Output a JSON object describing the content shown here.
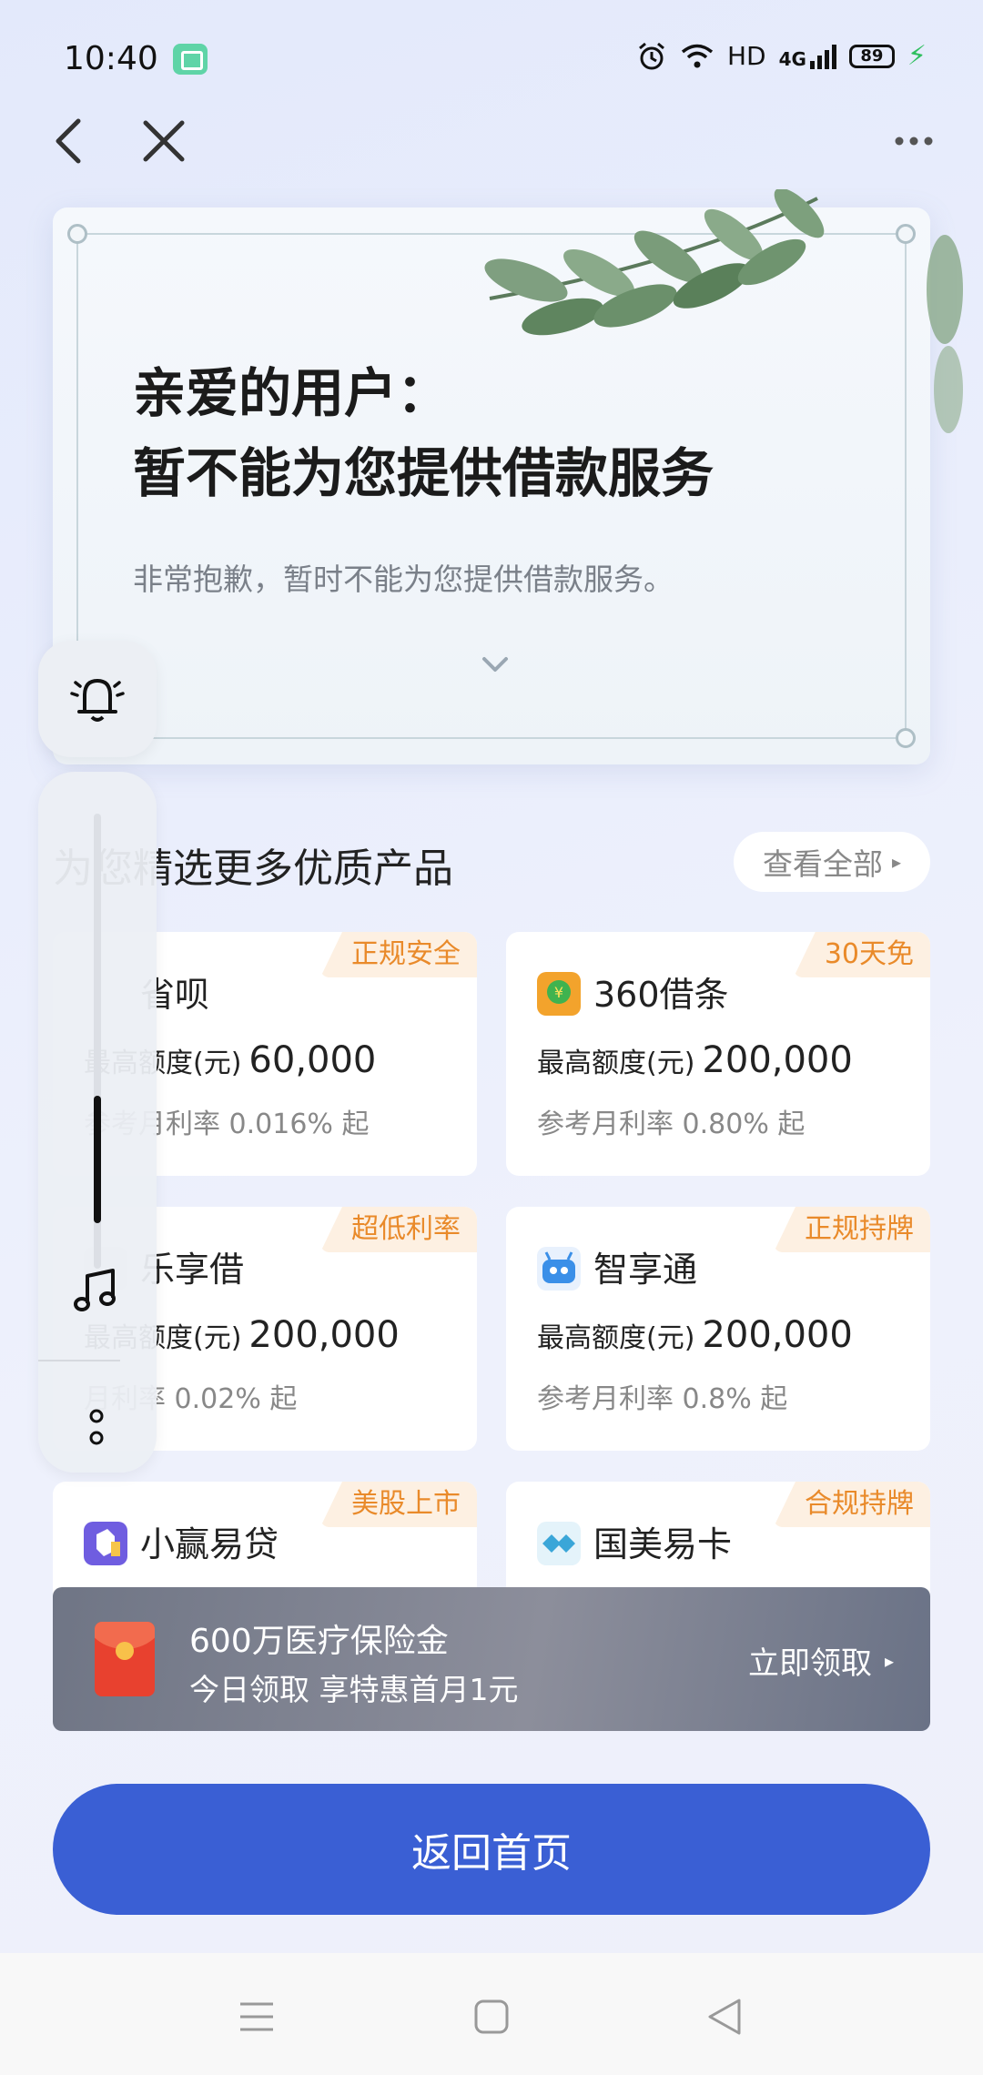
{
  "status_bar": {
    "time": "10:40",
    "network": "HD",
    "signal": "4G",
    "battery": "89"
  },
  "notice": {
    "title_line1": "亲爱的用户：",
    "title_line2": "暂不能为您提供借款服务",
    "description": "非常抱歉，暂时不能为您提供借款服务。"
  },
  "products": {
    "section_title": "为您精选更多优质产品",
    "view_all_label": "查看全部",
    "items": [
      {
        "name": "省呗",
        "tag": "正规安全",
        "limit_label": "最高额度(元)",
        "limit_value": "60,000",
        "rate": "参考月利率 0.016% 起",
        "logo_color": "#f2f2f2"
      },
      {
        "name": "360借条",
        "tag": "30天免",
        "limit_label": "最高额度(元)",
        "limit_value": "200,000",
        "rate": "参考月利率 0.80% 起",
        "logo_color": "#f3a32c"
      },
      {
        "name": "乐享借",
        "tag": "超低利率",
        "limit_label": "最高额度(元)",
        "limit_value": "200,000",
        "rate": "月利率 0.02% 起",
        "logo_color": "#e6e6e6"
      },
      {
        "name": "智享通",
        "tag": "正规持牌",
        "limit_label": "最高额度(元)",
        "limit_value": "200,000",
        "rate": "参考月利率 0.8% 起",
        "logo_color": "#3a8fe8"
      },
      {
        "name": "小赢易贷",
        "tag": "美股上市",
        "logo_color": "#6f5de0"
      },
      {
        "name": "国美易卡",
        "tag": "合规持牌",
        "logo_color": "#3aa6d8"
      }
    ]
  },
  "promo": {
    "title": "600万医疗保险金",
    "subtitle": "今日领取 享特惠首月1元",
    "action_label": "立即领取"
  },
  "home_button_label": "返回首页",
  "icons": {
    "back": "back-arrow-icon",
    "close": "close-icon",
    "more": "more-horizontal-icon",
    "bell": "bell-icon",
    "music": "music-note-icon"
  },
  "colors": {
    "primary": "#3a5fd4",
    "tag_text": "#e98a2a",
    "tag_bg": "#fdf0e2"
  }
}
